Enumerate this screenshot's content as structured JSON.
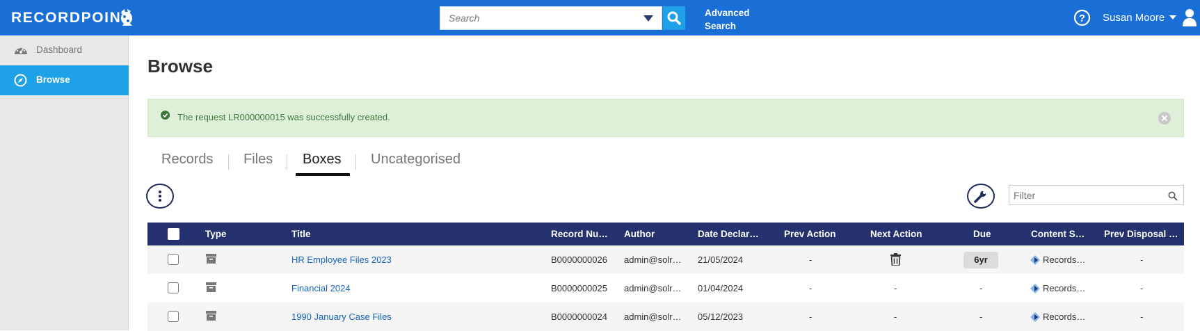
{
  "header": {
    "logo_text": "RECORDPOINT",
    "search_placeholder": "Search",
    "advanced_search_line1": "Advanced",
    "advanced_search_line2": "Search",
    "user_name": "Susan Moore",
    "bar_color": "#1a6fd6"
  },
  "sidebar": {
    "items": [
      {
        "label": "Dashboard",
        "icon": "dashboard-icon",
        "active": false
      },
      {
        "label": "Browse",
        "icon": "compass-icon",
        "active": true
      }
    ],
    "active_color": "#1ea1e6"
  },
  "main": {
    "title": "Browse",
    "alert": {
      "text": "The request LR000000015 was successfully created.",
      "type": "success"
    },
    "tabs": [
      {
        "label": "Records",
        "active": false
      },
      {
        "label": "Files",
        "active": false
      },
      {
        "label": "Boxes",
        "active": true
      },
      {
        "label": "Uncategorised",
        "active": false
      }
    ],
    "filter_placeholder": "Filter"
  },
  "table": {
    "header_color": "#24316e",
    "columns": [
      "Type",
      "Title",
      "Record Nu…",
      "Author",
      "Date Declar…",
      "Prev Action",
      "Next Action",
      "Due",
      "Content So…",
      "Prev Disposal …"
    ],
    "rows": [
      {
        "title": "HR Employee Files 2023",
        "record_number": "B0000000026",
        "author": "admin@solr…",
        "date_declared": "21/05/2024",
        "prev_action": "-",
        "next_action": "trash-icon",
        "due": "6yr",
        "content_source": "Records…",
        "prev_disposal": "-"
      },
      {
        "title": "Financial 2024",
        "record_number": "B0000000025",
        "author": "admin@solr…",
        "date_declared": "01/04/2024",
        "prev_action": "-",
        "next_action": "-",
        "due": "-",
        "content_source": "Records…",
        "prev_disposal": "-"
      },
      {
        "title": "1990 January Case Files",
        "record_number": "B0000000024",
        "author": "admin@solr…",
        "date_declared": "05/12/2023",
        "prev_action": "-",
        "next_action": "-",
        "due": "-",
        "content_source": "Records…",
        "prev_disposal": "-"
      }
    ]
  }
}
